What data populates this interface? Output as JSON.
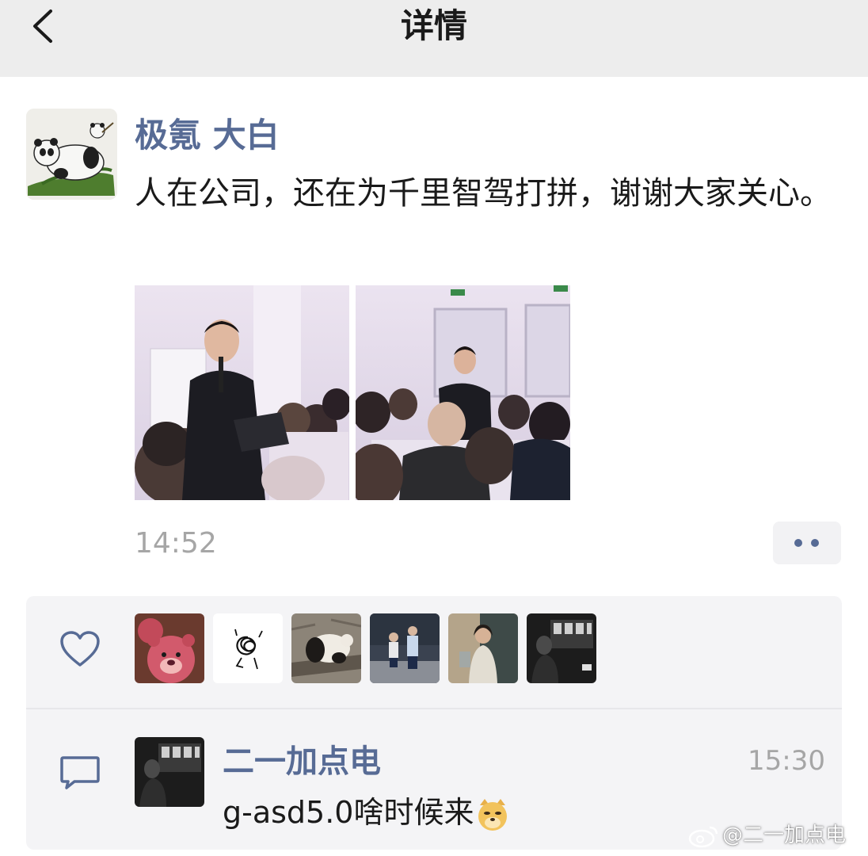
{
  "header": {
    "title": "详情",
    "back_icon": "chevron-left-icon"
  },
  "post": {
    "author": "极氪 大白",
    "text": "人在公司，还在为千里智驾打拼，谢谢大家关心。",
    "time": "14:52",
    "photos": [
      "photo-speaker-with-microphone",
      "photo-conference-room-audience"
    ]
  },
  "likes": {
    "icon": "heart-icon",
    "avatars": [
      "lotso-bear-avatar",
      "scribble-drawing-avatar",
      "panda-avatar",
      "two-children-avatar",
      "woman-selfie-avatar",
      "dark-room-avatar"
    ]
  },
  "comment": {
    "icon": "comment-icon",
    "author": "二一加点电",
    "time": "15:30",
    "text": "g-asd5.0啥时候来",
    "emoji": "doge-emoji"
  },
  "watermark": {
    "text": "@二一加点电",
    "icon": "weibo-icon"
  },
  "colors": {
    "link": "#576b95",
    "header_bg": "#ededed",
    "panel_bg": "#f4f4f6",
    "muted": "#a6a6a6"
  }
}
